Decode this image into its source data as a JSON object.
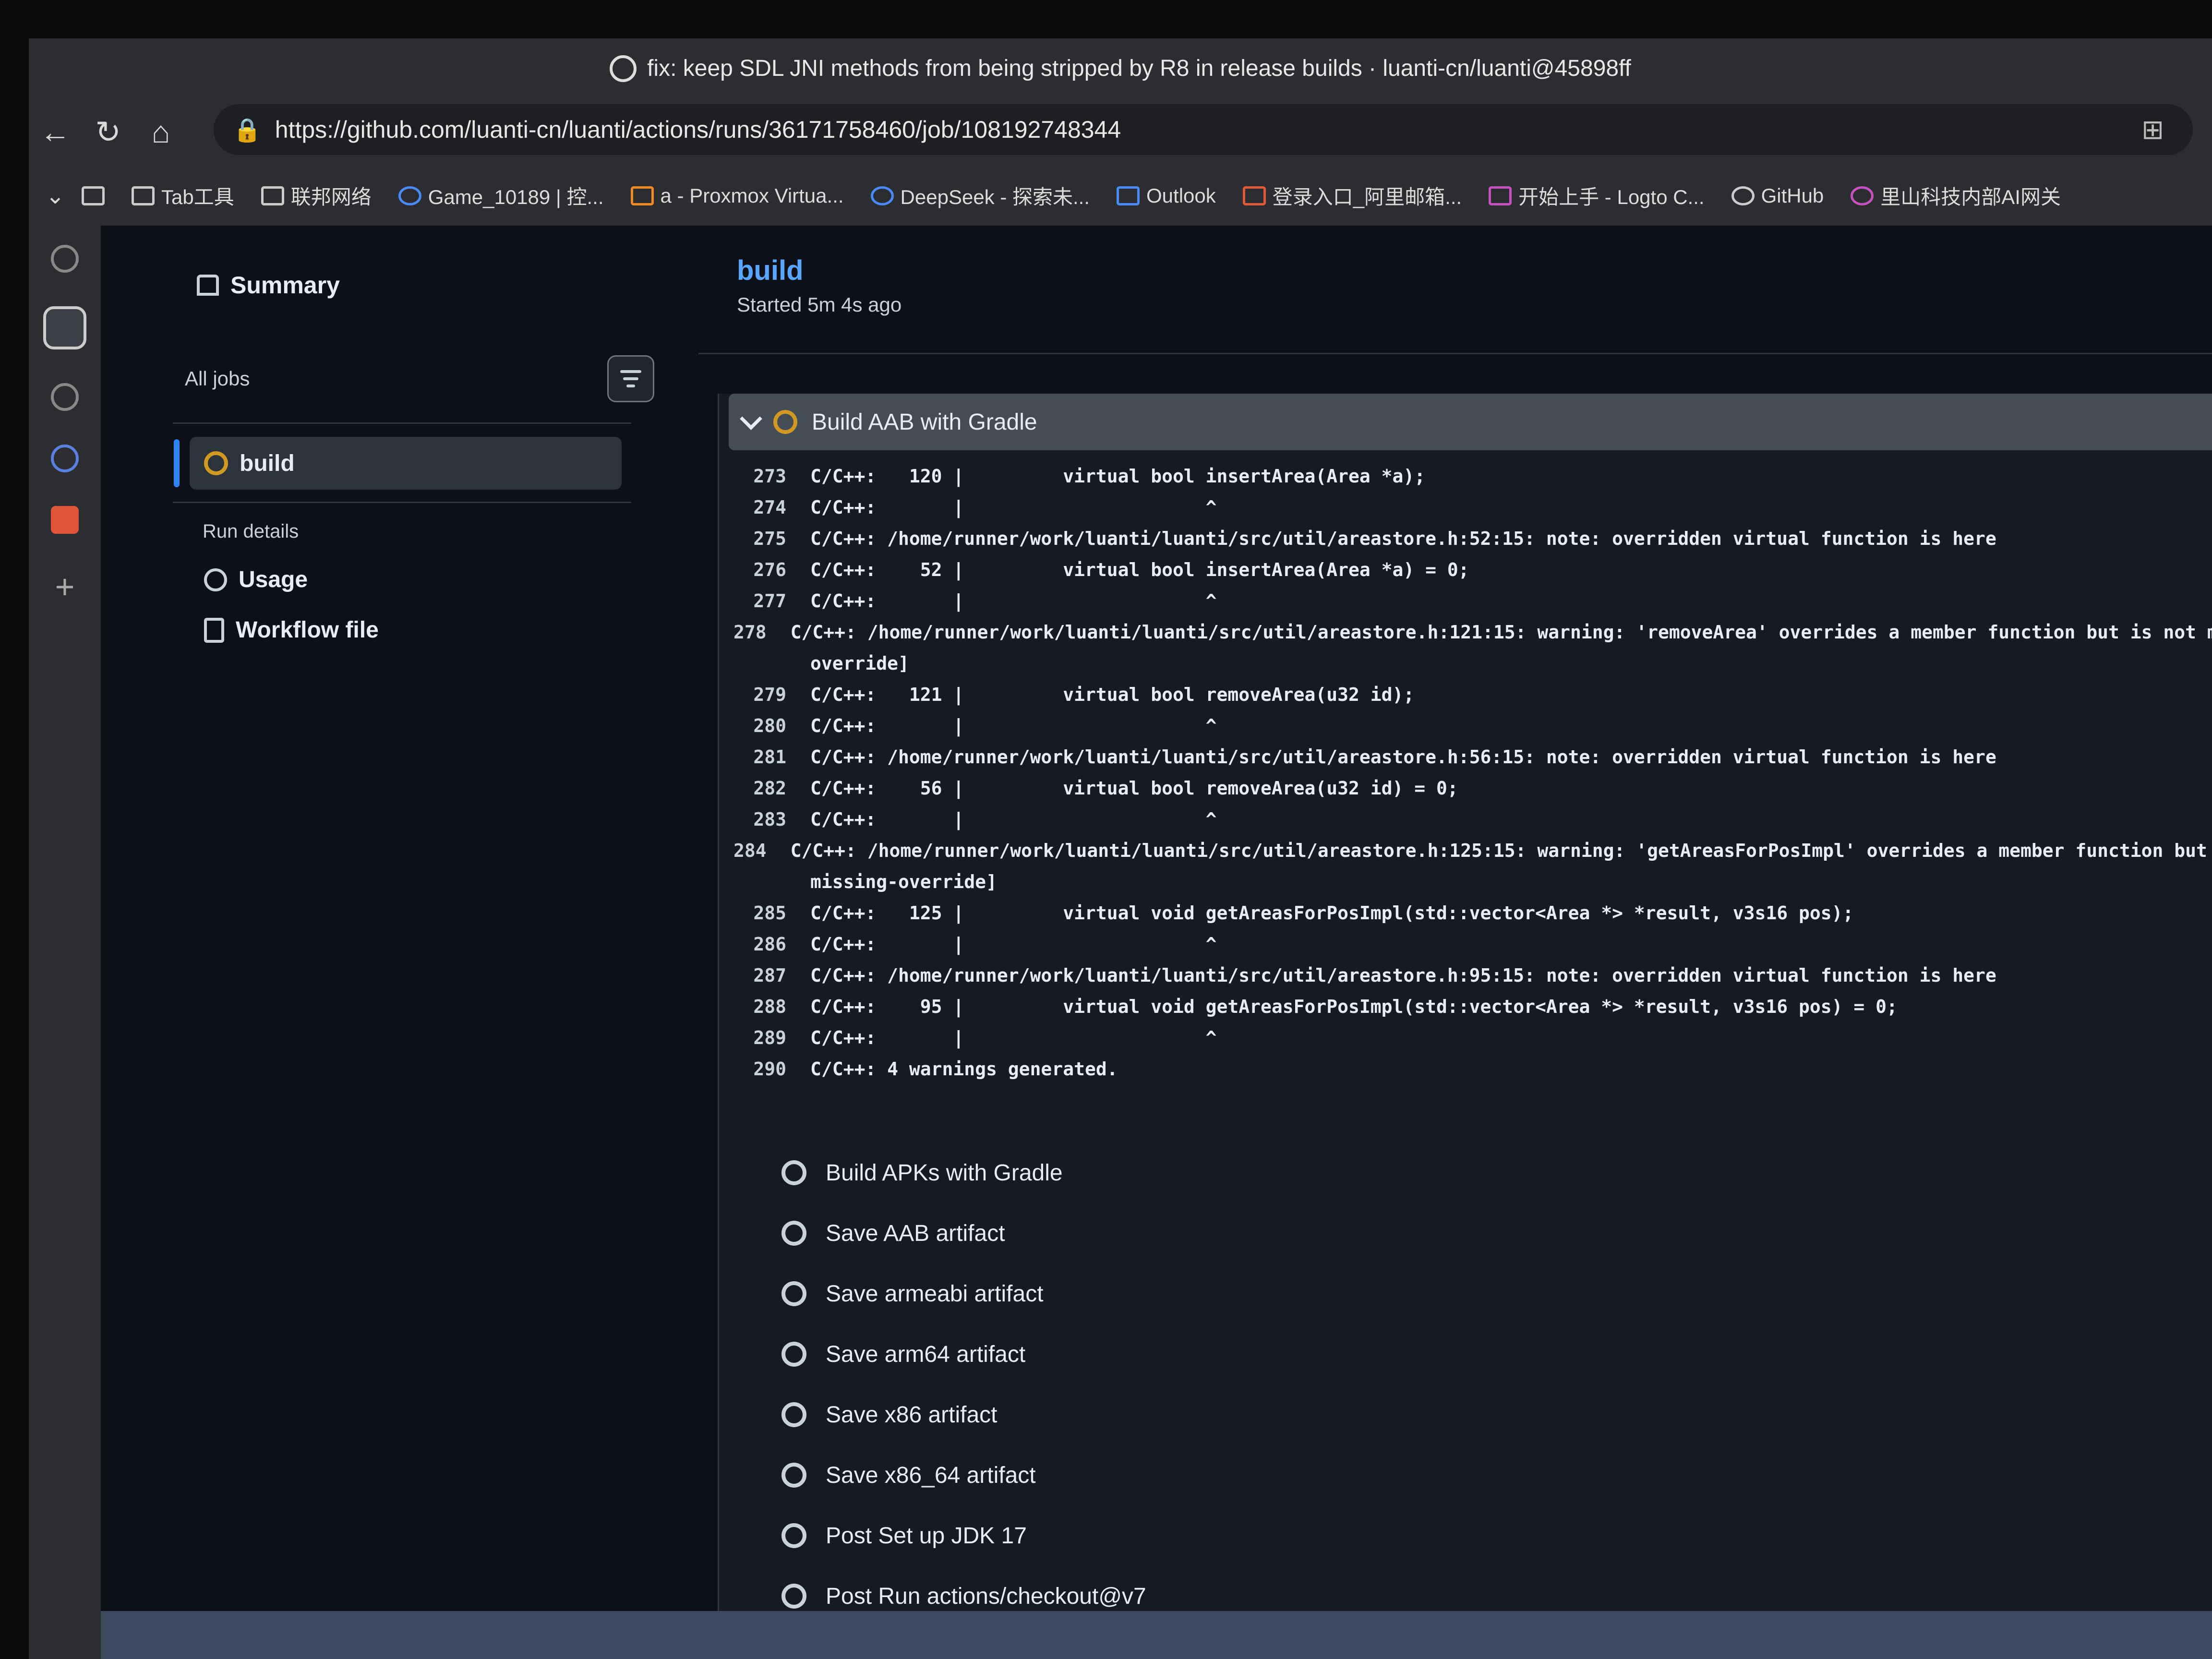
{
  "window": {
    "title": "fix: keep SDL JNI methods from being stripped by R8 in release builds · luanti-cn/luanti@45898ff"
  },
  "browser": {
    "url": "https://github.com/luanti-cn/luanti/actions/runs/36171758460/job/108192748344",
    "bookmarks": [
      {
        "label": "",
        "icon": "reading-list-icon"
      },
      {
        "label": "Tab工具",
        "icon": "folder-icon"
      },
      {
        "label": "联邦网络",
        "icon": "folder-icon"
      },
      {
        "label": "Game_10189 | 控...",
        "icon": "game-icon"
      },
      {
        "label": "a - Proxmox Virtua...",
        "icon": "proxmox-icon"
      },
      {
        "label": "DeepSeek - 探索未...",
        "icon": "deepseek-icon"
      },
      {
        "label": "Outlook",
        "icon": "outlook-icon"
      },
      {
        "label": "登录入口_阿里邮箱...",
        "icon": "mail-icon"
      },
      {
        "label": "开始上手 - Logto C...",
        "icon": "logto-icon"
      },
      {
        "label": "GitHub",
        "icon": "github-icon"
      },
      {
        "label": "里山科技内部AI网关",
        "icon": "ai-gateway-icon"
      }
    ]
  },
  "sidebar": {
    "summary_label": "Summary",
    "all_jobs_label": "All jobs",
    "active_job": "build",
    "run_details_label": "Run details",
    "usage_label": "Usage",
    "workflow_file_label": "Workflow file"
  },
  "job": {
    "title": "build",
    "started": "Started 5m 4s ago",
    "current_step": "Build AAB with Gradle"
  },
  "log_lines": [
    {
      "n": "273",
      "text": "C/C++:   120 |         virtual bool insertArea(Area *a);"
    },
    {
      "n": "274",
      "text": "C/C++:       |                      ^"
    },
    {
      "n": "275",
      "text": "C/C++: /home/runner/work/luanti/luanti/src/util/areastore.h:52:15: note: overridden virtual function is here"
    },
    {
      "n": "276",
      "text": "C/C++:    52 |         virtual bool insertArea(Area *a) = 0;"
    },
    {
      "n": "277",
      "text": "C/C++:       |                      ^"
    },
    {
      "n": "278",
      "text": "C/C++: /home/runner/work/luanti/luanti/src/util/areastore.h:121:15: warning: 'removeArea' overrides a member function but is not marked",
      "cont": "override]"
    },
    {
      "n": "279",
      "text": "C/C++:   121 |         virtual bool removeArea(u32 id);"
    },
    {
      "n": "280",
      "text": "C/C++:       |                      ^"
    },
    {
      "n": "281",
      "text": "C/C++: /home/runner/work/luanti/luanti/src/util/areastore.h:56:15: note: overridden virtual function is here"
    },
    {
      "n": "282",
      "text": "C/C++:    56 |         virtual bool removeArea(u32 id) = 0;"
    },
    {
      "n": "283",
      "text": "C/C++:       |                      ^"
    },
    {
      "n": "284",
      "text": "C/C++: /home/runner/work/luanti/luanti/src/util/areastore.h:125:15: warning: 'getAreasForPosImpl' overrides a member function but is not",
      "cont": "missing-override]"
    },
    {
      "n": "285",
      "text": "C/C++:   125 |         virtual void getAreasForPosImpl(std::vector<Area *> *result, v3s16 pos);"
    },
    {
      "n": "286",
      "text": "C/C++:       |                      ^"
    },
    {
      "n": "287",
      "text": "C/C++: /home/runner/work/luanti/luanti/src/util/areastore.h:95:15: note: overridden virtual function is here"
    },
    {
      "n": "288",
      "text": "C/C++:    95 |         virtual void getAreasForPosImpl(std::vector<Area *> *result, v3s16 pos) = 0;"
    },
    {
      "n": "289",
      "text": "C/C++:       |                      ^"
    },
    {
      "n": "290",
      "text": "C/C++: 4 warnings generated."
    }
  ],
  "pending_steps": [
    "Build APKs with Gradle",
    "Save AAB artifact",
    "Save armeabi artifact",
    "Save arm64 artifact",
    "Save x86 artifact",
    "Save x86_64 artifact",
    "Post Set up JDK 17",
    "Post Run actions/checkout@v7"
  ]
}
